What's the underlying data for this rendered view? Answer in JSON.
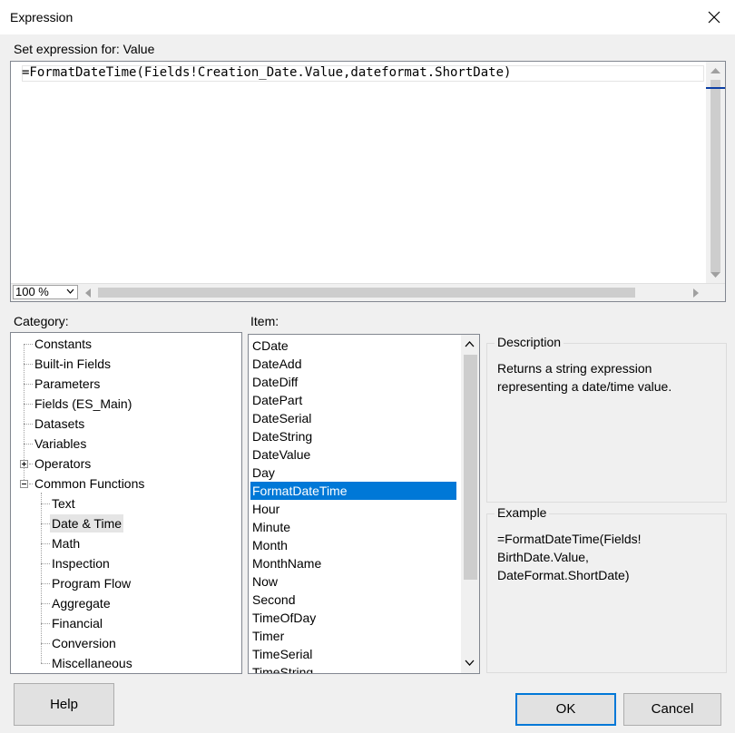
{
  "window": {
    "title": "Expression"
  },
  "expression": {
    "label": "Set expression for: Value",
    "code": "=FormatDateTime(Fields!Creation_Date.Value,dateformat.ShortDate)",
    "zoom": "100 %"
  },
  "category": {
    "label": "Category:",
    "items": [
      "Constants",
      "Built-in Fields",
      "Parameters",
      "Fields (ES_Main)",
      "Datasets",
      "Variables",
      "Operators",
      "Common Functions"
    ],
    "sub_items": [
      "Text",
      "Date & Time",
      "Math",
      "Inspection",
      "Program Flow",
      "Aggregate",
      "Financial",
      "Conversion",
      "Miscellaneous"
    ],
    "selected": "Date & Time"
  },
  "item": {
    "label": "Item:",
    "items": [
      "CDate",
      "DateAdd",
      "DateDiff",
      "DatePart",
      "DateSerial",
      "DateString",
      "DateValue",
      "Day",
      "FormatDateTime",
      "Hour",
      "Minute",
      "Month",
      "MonthName",
      "Now",
      "Second",
      "TimeOfDay",
      "Timer",
      "TimeSerial",
      "TimeString"
    ],
    "selected": "FormatDateTime"
  },
  "description": {
    "title": "Description",
    "lines": [
      "Returns a string expression",
      "representing a date/time value."
    ]
  },
  "example": {
    "title": "Example",
    "lines": [
      "=FormatDateTime(Fields!",
      "BirthDate.Value,",
      "DateFormat.ShortDate)"
    ]
  },
  "buttons": {
    "help": "Help",
    "ok": "OK",
    "cancel": "Cancel"
  }
}
